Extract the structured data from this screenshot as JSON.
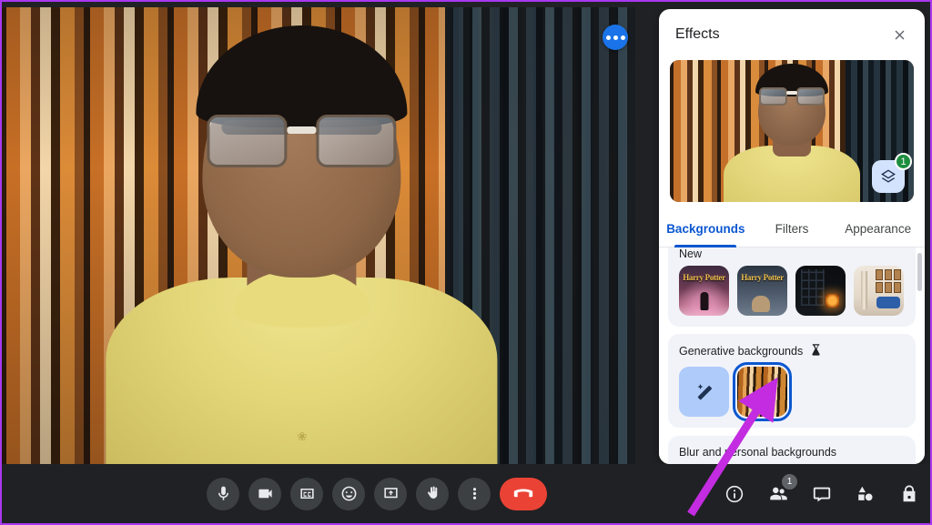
{
  "app": {
    "accent_blue": "#1a73e8",
    "selected_outline": "#0b57d0",
    "badge_green": "#1e8e3e",
    "end_call_red": "#ea4335",
    "annotation_color": "#c32ce0",
    "frame_border": "#a838f0"
  },
  "video": {
    "more_options_label": "More options",
    "shirt_logo": "❀",
    "background_name": "forest-generative-background"
  },
  "panel": {
    "title": "Effects",
    "close_label": "Close",
    "preview": {
      "layers_button_label": "Backgrounds and effects layers",
      "layers_badge": "1"
    },
    "tabs": [
      {
        "label": "Backgrounds",
        "active": true
      },
      {
        "label": "Filters",
        "active": false
      },
      {
        "label": "Appearance",
        "active": false
      }
    ],
    "sections": [
      {
        "title": "New",
        "clipped": true,
        "thumbnails": [
          {
            "name": "harry-potter-great-hall",
            "caption": "Harry Potter"
          },
          {
            "name": "harry-potter-street",
            "caption": "Harry Potter"
          },
          {
            "name": "dark-room-fireplace",
            "caption": ""
          },
          {
            "name": "living-room-portraits",
            "caption": ""
          }
        ]
      },
      {
        "title": "Generative backgrounds",
        "experimental_icon": "flask-icon",
        "thumbnails": [
          {
            "name": "create-with-prompt",
            "caption": "",
            "icon": "magic-wand-icon"
          },
          {
            "name": "generated-forest-background",
            "caption": "",
            "selected": true
          }
        ]
      },
      {
        "title": "Blur and personal backgrounds",
        "thumbnails": [
          {
            "name": "slight-blur",
            "caption": ""
          },
          {
            "name": "full-blur",
            "caption": ""
          }
        ]
      }
    ],
    "scrollbar_label": "Effects list scrollbar"
  },
  "bottom_bar": {
    "center_controls": [
      {
        "name": "microphone-button",
        "icon": "microphone-icon",
        "label": "Turn off microphone"
      },
      {
        "name": "camera-button",
        "icon": "video-camera-icon",
        "label": "Turn off camera"
      },
      {
        "name": "captions-button",
        "icon": "closed-captions-icon",
        "label": "Turn on captions"
      },
      {
        "name": "emoji-button",
        "icon": "emoji-icon",
        "label": "Send a reaction"
      },
      {
        "name": "present-button",
        "icon": "present-screen-icon",
        "label": "Present now"
      },
      {
        "name": "raise-hand-button",
        "icon": "raised-hand-icon",
        "label": "Raise hand"
      },
      {
        "name": "more-options-button",
        "icon": "three-dots-vertical-icon",
        "label": "More options"
      },
      {
        "name": "end-call-button",
        "icon": "phone-hangup-icon",
        "label": "Leave call"
      }
    ],
    "right_controls": [
      {
        "name": "meeting-details-button",
        "icon": "info-icon",
        "label": "Meeting details",
        "badge": ""
      },
      {
        "name": "people-button",
        "icon": "people-icon",
        "label": "People",
        "badge": "1"
      },
      {
        "name": "chat-button",
        "icon": "chat-bubble-icon",
        "label": "Chat with everyone",
        "badge": ""
      },
      {
        "name": "activities-button",
        "icon": "activities-shapes-icon",
        "label": "Activities",
        "badge": ""
      },
      {
        "name": "host-controls-button",
        "icon": "lock-icon",
        "label": "Host controls",
        "badge": ""
      }
    ]
  },
  "annotation": {
    "arrow_name": "pointer-arrow-to-generated-background",
    "color": "#c32ce0"
  }
}
